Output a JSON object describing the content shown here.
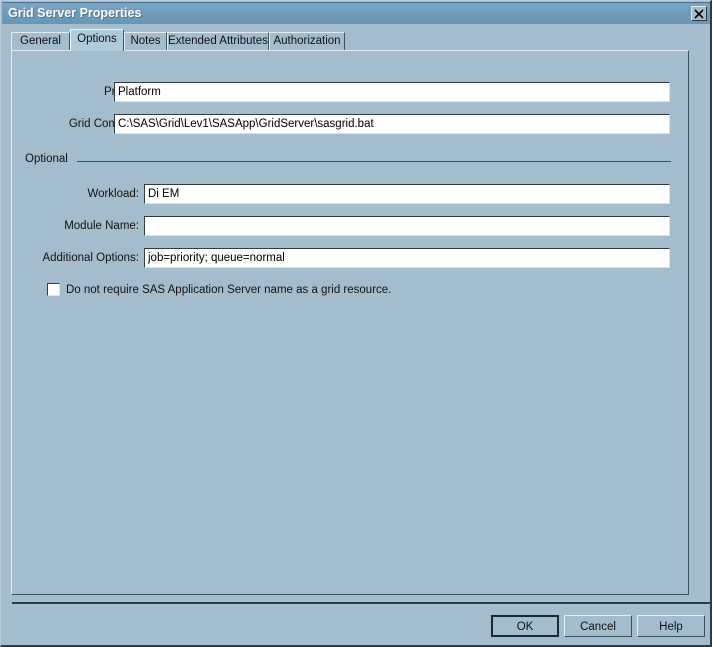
{
  "window": {
    "title": "Grid Server Properties",
    "close_icon": "close-icon",
    "close_glyph": "X",
    "background_color": "#a3bdcd",
    "titlebar_color": "#6e9cbc",
    "title_text_color": "#ffffff"
  },
  "tabs": [
    {
      "label": "General",
      "selected": false
    },
    {
      "label": "Options",
      "selected": true
    },
    {
      "label": "Notes",
      "selected": false
    },
    {
      "label": "Extended Attributes",
      "selected": false
    },
    {
      "label": "Authorization",
      "selected": false
    }
  ],
  "form": {
    "fields": [
      {
        "label": "Provider:",
        "value": "Platform",
        "placeholder": ""
      },
      {
        "label": "Grid Command:",
        "value": "C:\\SAS\\Grid\\Lev1\\SASApp\\GridServer\\sasgrid.bat",
        "placeholder": ""
      }
    ],
    "group": {
      "title": "Optional",
      "fields": [
        {
          "label": "Workload:",
          "value": "Di EM",
          "placeholder": ""
        },
        {
          "label": "Module Name:",
          "value": "",
          "placeholder": ""
        },
        {
          "label": "Additional Options:",
          "value": "job=priority; queue=normal",
          "placeholder": ""
        }
      ],
      "checkbox": {
        "label": "Do not require SAS Application Server name as a grid resource.",
        "checked": false
      }
    }
  },
  "buttons": {
    "ok": "OK",
    "cancel": "Cancel",
    "help": "Help"
  }
}
